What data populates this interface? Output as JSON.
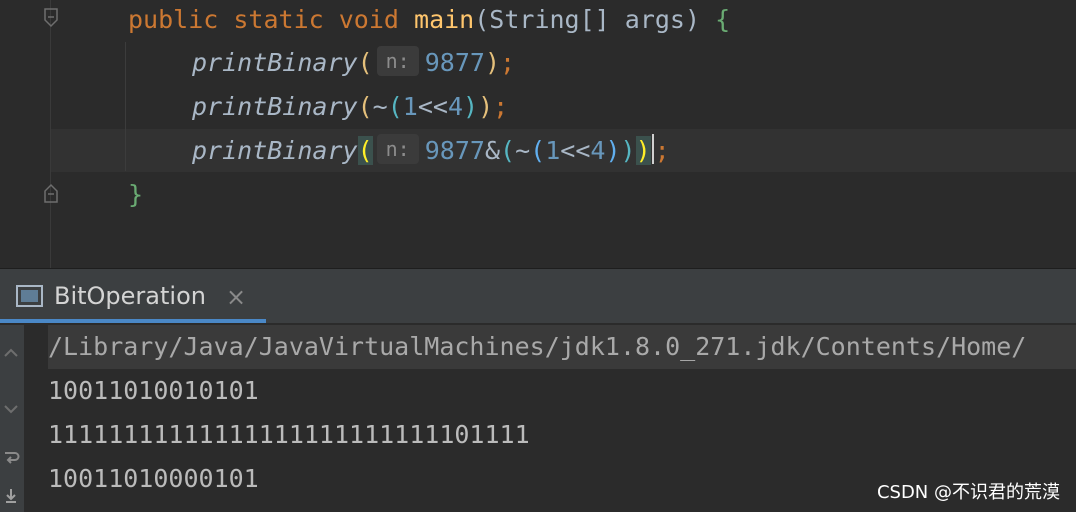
{
  "editor": {
    "line1": {
      "kw1": "public",
      "kw2": "static",
      "kw3": "void",
      "method": "main",
      "params": "(String[] args)",
      "brace": "{"
    },
    "line2": {
      "call": "printBinary",
      "hint": "n:",
      "arg": "9877",
      "close": ")",
      "semi": ";"
    },
    "line3": {
      "call": "printBinary",
      "open": "(",
      "tilde": "~",
      "p2open": "(",
      "one": "1",
      "shift": "<<",
      "four": "4",
      "p2close": ")",
      "close": ")",
      "semi": ";"
    },
    "line4": {
      "call": "printBinary",
      "open": "(",
      "hint": "n:",
      "arg": "9877",
      "amp": "&",
      "p2open": "(",
      "tilde": "~",
      "p3open": "(",
      "one": "1",
      "shift": "<<",
      "four": "4",
      "p3close": ")",
      "p2close": ")",
      "close": ")",
      "semi": ";"
    },
    "line5": {
      "brace": "}"
    }
  },
  "run_panel": {
    "tab_label": "BitOperation",
    "close_glyph": "×",
    "console": {
      "command": "/Library/Java/JavaVirtualMachines/jdk1.8.0_271.jdk/Contents/Home/",
      "output": [
        "10011010010101",
        "11111111111111111111111111101111",
        "10011010000101"
      ]
    }
  },
  "watermark": "CSDN @不识君的荒漠",
  "colors": {
    "keyword": "#cc7832",
    "method": "#ffc66d",
    "number": "#6897bb",
    "tab_accent": "#4a88c7",
    "background": "#2b2b2b"
  }
}
